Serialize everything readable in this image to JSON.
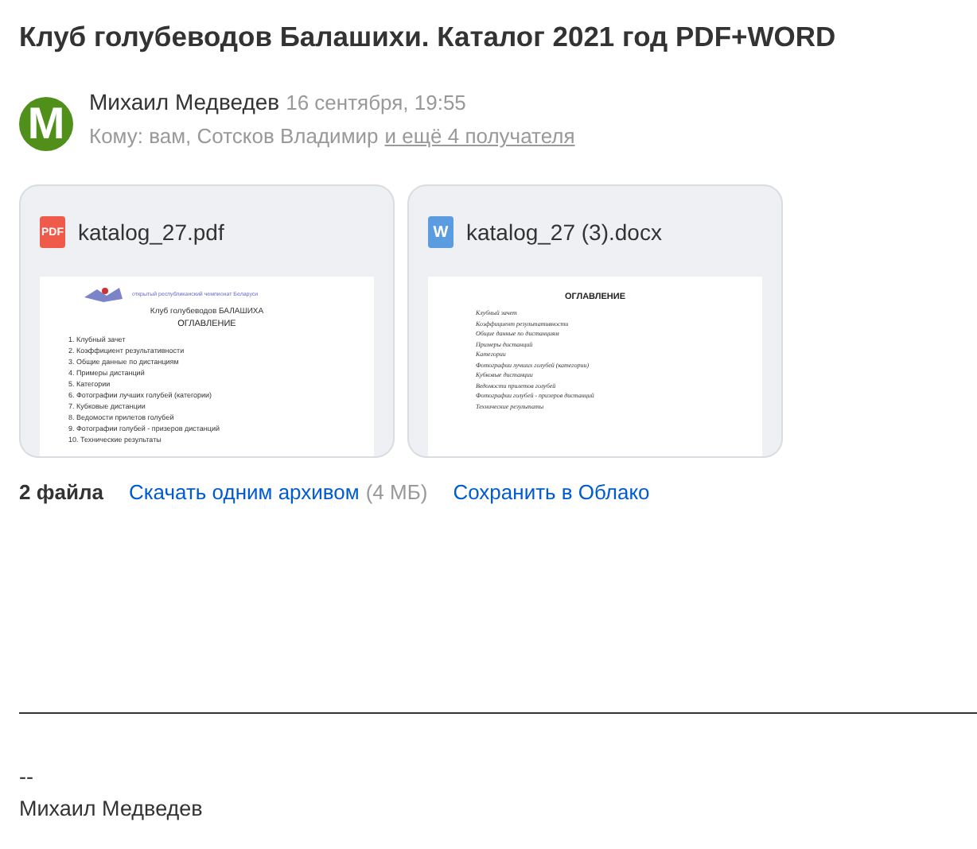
{
  "subject": "Клуб голубеводов Балашихи. Каталог 2021 год PDF+WORD",
  "sender": {
    "avatar_letter": "M",
    "name": "Михаил Медведев",
    "date": "16 сентября, 19:55"
  },
  "recipients": {
    "label": "Кому: вам, Сотсков Владимир",
    "more_link": "и ещё 4 получателя"
  },
  "attachments": [
    {
      "kind": "pdf",
      "icon_text": "PDF",
      "name": "katalog_27.pdf",
      "preview": {
        "header_line": "открытый республиканский чемпионат Беларуси",
        "title": "Клуб голубеводов БАЛАШИХА",
        "heading": "ОГЛАВЛЕНИЕ",
        "items": [
          "1. Клубный зачет",
          "2. Коэффициент результативности",
          "3. Общие данные по дистанциям",
          "4. Примеры дистанций",
          "5. Категории",
          "6. Фотографии лучших голубей (категории)",
          "7. Кубковые дистанции",
          "8. Ведомости прилетов голубей",
          "9. Фотографии голубей - призеров дистанций",
          "10. Технические результаты"
        ]
      }
    },
    {
      "kind": "word",
      "icon_text": "W",
      "name": "katalog_27 (3).docx",
      "preview": {
        "heading": "ОГЛАВЛЕНИЕ",
        "items": [
          "Клубный зачет",
          "Коэффициент результативности",
          "Общие данные по дистанциям",
          "Примеры дистанций",
          "Категории",
          "Фотографии лучших голубей (категории)",
          "Кубковые дистанции",
          "Ведомости прилетов голубей",
          "Фотографии голубей - призеров дистанций",
          "Технические результаты"
        ]
      }
    }
  ],
  "attachments_footer": {
    "count": "2 файла",
    "download_link": "Скачать одним архивом",
    "size": "(4 МБ)",
    "cloud_link": "Сохранить в Облако"
  },
  "signature": {
    "separator": "--",
    "name": "Михаил Медведев"
  }
}
